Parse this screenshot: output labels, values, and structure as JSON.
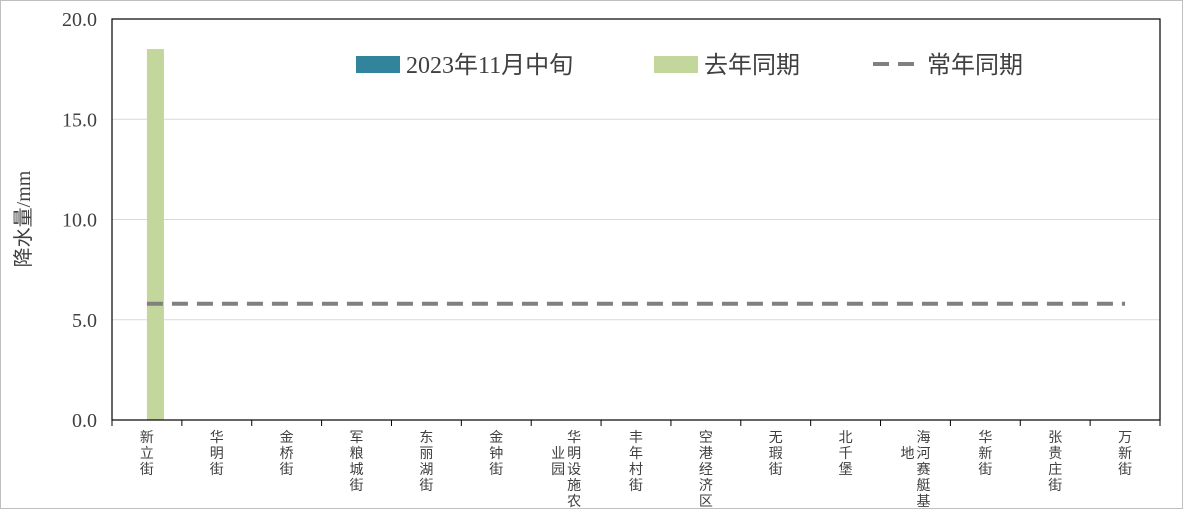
{
  "chart_data": {
    "type": "bar",
    "ylabel": "降水量/mm",
    "xlabel": "",
    "ylim": [
      0,
      20
    ],
    "yticks": [
      "0.0",
      "5.0",
      "10.0",
      "15.0",
      "20.0"
    ],
    "grid": true,
    "legend_position": "top",
    "categories": [
      "新立街",
      "华明街",
      "金桥街",
      "军粮城街",
      "东丽湖街",
      "金钟街",
      "华明设施农业园",
      "丰年村街",
      "空港经济区",
      "无瑕街",
      "北千堡",
      "海河寨艇基地",
      "华新街",
      "张贵庄街",
      "万新街"
    ],
    "category_label_lines": [
      [
        [
          "新",
          "立",
          "街"
        ]
      ],
      [
        [
          "华",
          "明",
          "街"
        ]
      ],
      [
        [
          "金",
          "桥",
          "街"
        ]
      ],
      [
        [
          "军",
          "粮",
          "城",
          "街"
        ]
      ],
      [
        [
          "东",
          "丽",
          "湖",
          "街"
        ]
      ],
      [
        [
          "金",
          "钟",
          "街"
        ]
      ],
      [
        [
          "华",
          "明",
          "设",
          "施",
          "农"
        ],
        [
          "业",
          "园"
        ]
      ],
      [
        [
          "丰",
          "年",
          "村",
          "街"
        ]
      ],
      [
        [
          "空",
          "港",
          "经",
          "济",
          "区"
        ]
      ],
      [
        [
          "无",
          "瑕",
          "街"
        ]
      ],
      [
        [
          "北",
          "千",
          "堡"
        ]
      ],
      [
        [
          "海",
          "河",
          "赛",
          "艇",
          "基"
        ],
        [
          "地"
        ]
      ],
      [
        [
          "华",
          "新",
          "街"
        ]
      ],
      [
        [
          "张",
          "贵",
          "庄",
          "街"
        ]
      ],
      [
        [
          "万",
          "新",
          "街"
        ]
      ]
    ],
    "series": [
      {
        "name": "2023年11月中旬",
        "type": "bar",
        "color": "#31849b",
        "values": [
          0,
          0,
          0,
          0,
          0,
          0,
          0,
          0,
          0,
          0,
          0,
          0,
          0,
          0,
          0
        ]
      },
      {
        "name": "去年同期",
        "type": "bar",
        "color": "#c3d69b",
        "values": [
          18.5,
          0,
          0,
          0,
          0,
          0,
          0,
          0,
          0,
          0,
          0,
          0,
          0,
          0,
          0
        ]
      },
      {
        "name": "常年同期",
        "type": "line-dashed",
        "color": "#808080",
        "values": [
          5.8,
          5.8,
          5.8,
          5.8,
          5.8,
          5.8,
          5.8,
          5.8,
          5.8,
          5.8,
          5.8,
          5.8,
          5.8,
          5.8,
          5.8
        ]
      }
    ]
  }
}
